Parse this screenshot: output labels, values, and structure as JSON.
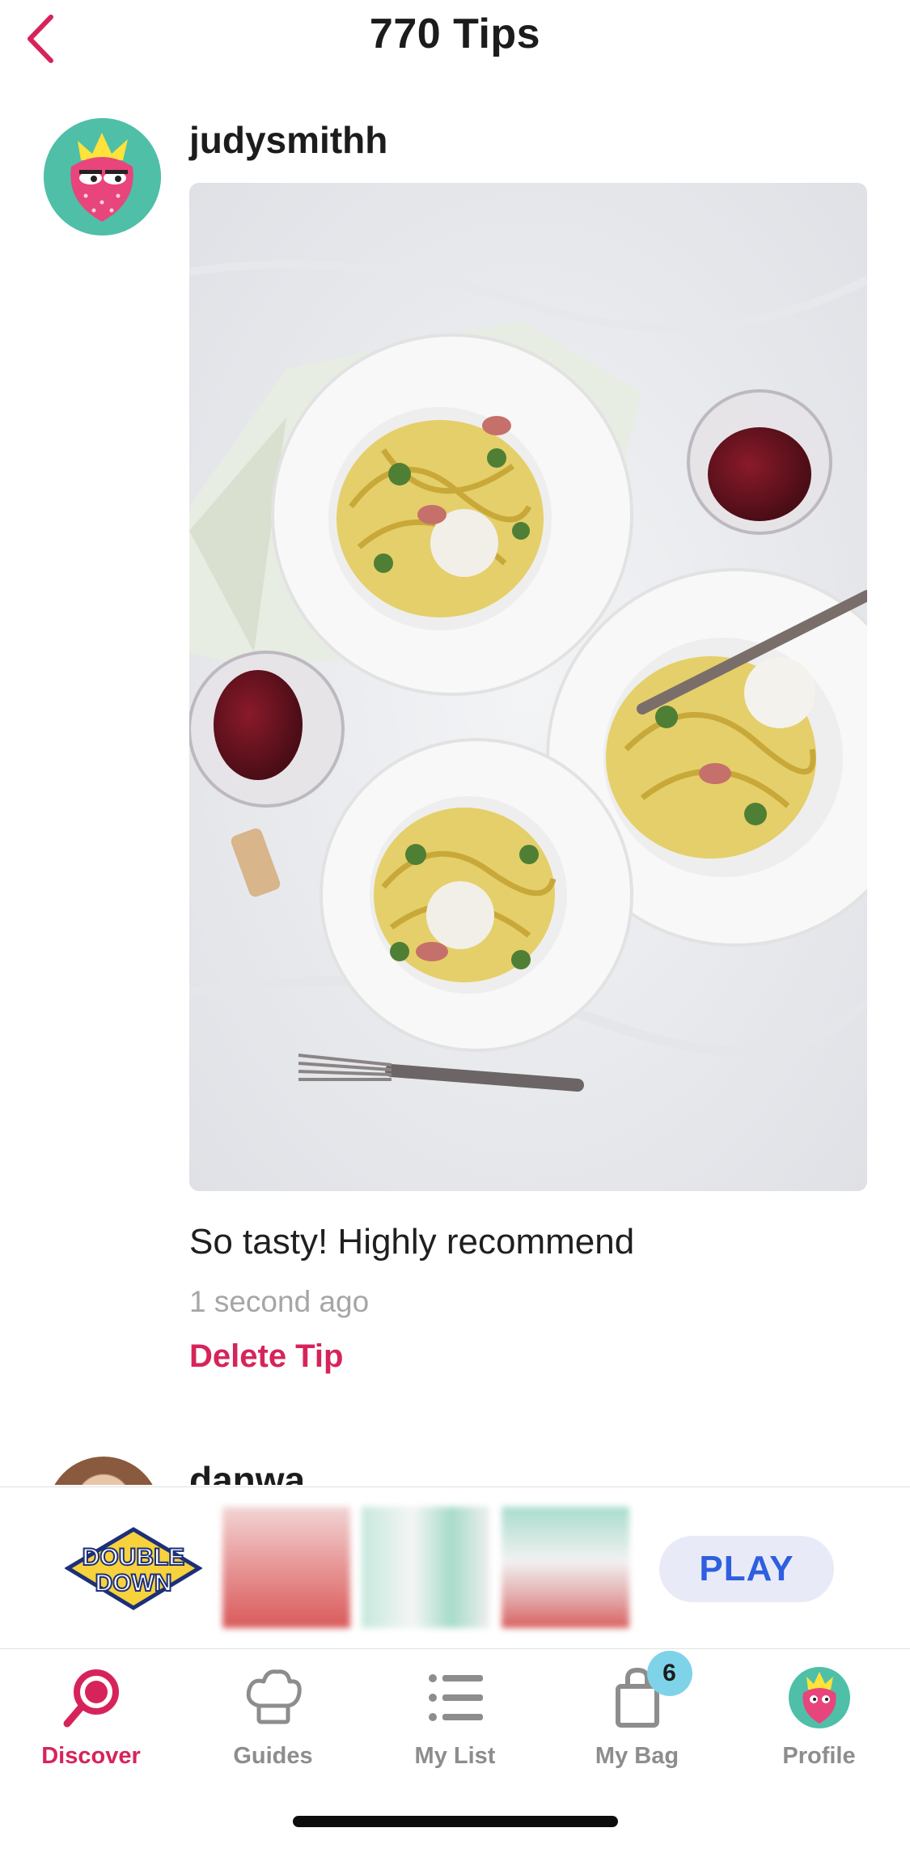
{
  "header": {
    "title": "770 Tips"
  },
  "tip": {
    "username": "judysmithh",
    "text": "So tasty! Highly recommend",
    "time": "1 second ago",
    "delete_label": "Delete Tip"
  },
  "next_tip": {
    "username": "danwa"
  },
  "ad": {
    "logo_text_1": "DOUBLE",
    "logo_text_2": "DOWN",
    "play_label": "PLAY"
  },
  "tabbar": {
    "items": [
      {
        "label": "Discover",
        "icon": "search-icon",
        "active": true
      },
      {
        "label": "Guides",
        "icon": "chef-hat-icon",
        "active": false
      },
      {
        "label": "My List",
        "icon": "list-icon",
        "active": false
      },
      {
        "label": "My Bag",
        "icon": "bag-icon",
        "active": false,
        "badge": "6"
      },
      {
        "label": "Profile",
        "icon": "profile-avatar-icon",
        "active": false
      }
    ]
  },
  "colors": {
    "accent": "#d6245a",
    "play": "#2f5fe0",
    "badge": "#7fd3e8"
  }
}
